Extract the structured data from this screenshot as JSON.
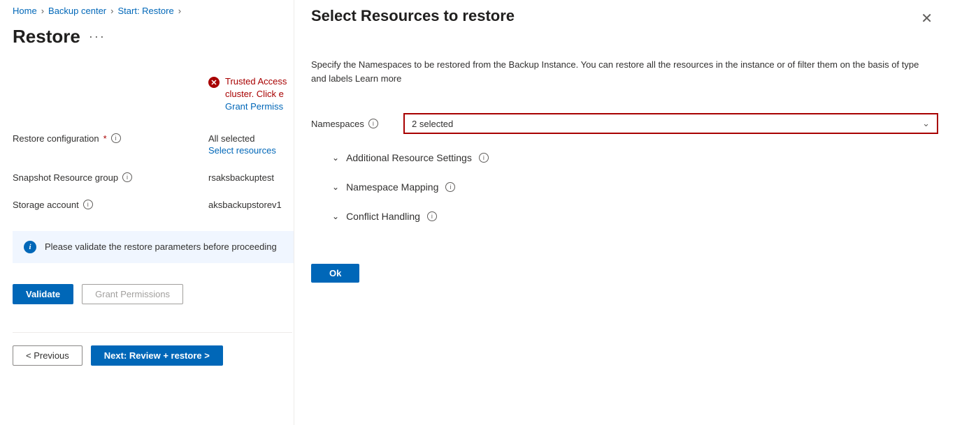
{
  "breadcrumb": {
    "home": "Home",
    "backup_center": "Backup center",
    "start_restore": "Start: Restore"
  },
  "page_title": "Restore",
  "trusted_access": {
    "line1": "Trusted Access",
    "line2": "cluster. Click e",
    "grant_link": "Grant Permiss"
  },
  "form": {
    "restore_config_label": "Restore configuration",
    "restore_config_value": "All selected",
    "select_resources_link": "Select resources",
    "snapshot_rg_label": "Snapshot Resource group",
    "snapshot_rg_value": "rsaksbackuptest",
    "storage_account_label": "Storage account",
    "storage_account_value": "aksbackupstorev1"
  },
  "info_banner": "Please validate the restore parameters before proceeding",
  "buttons": {
    "validate": "Validate",
    "grant_permissions": "Grant Permissions",
    "previous": "< Previous",
    "next": "Next: Review + restore >"
  },
  "panel": {
    "title": "Select Resources to restore",
    "desc": "Specify the Namespaces to be restored from the Backup Instance. You can restore all the resources in the instance or of filter them on the basis of type and labels Learn more",
    "namespaces_label": "Namespaces",
    "namespaces_value": "2 selected",
    "expanders": {
      "additional": "Additional Resource Settings",
      "mapping": "Namespace Mapping",
      "conflict": "Conflict Handling"
    },
    "ok": "Ok"
  }
}
